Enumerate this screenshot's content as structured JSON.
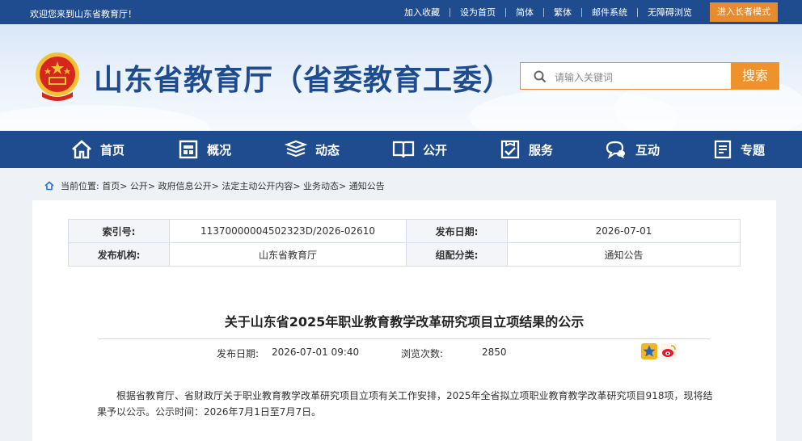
{
  "topbar": {
    "welcome": "欢迎您来到山东省教育厅！",
    "links": [
      "加入收藏",
      "设为首页",
      "简体",
      "繁体",
      "邮件系统",
      "无障碍浏览"
    ],
    "elder_mode": "进入长者模式"
  },
  "header": {
    "site_title": "山东省教育厅（省委教育工委）",
    "search_placeholder": "请输入关键词",
    "search_button": "搜索"
  },
  "nav": {
    "items": [
      {
        "label": "首页",
        "icon": "home-icon"
      },
      {
        "label": "概况",
        "icon": "overview-icon"
      },
      {
        "label": "动态",
        "icon": "news-icon"
      },
      {
        "label": "公开",
        "icon": "book-icon"
      },
      {
        "label": "服务",
        "icon": "service-icon"
      },
      {
        "label": "互动",
        "icon": "chat-icon"
      },
      {
        "label": "专题",
        "icon": "topic-icon"
      }
    ]
  },
  "breadcrumb": {
    "text": "当前位置: 首页> 公开> 政府信息公开> 法定主动公开内容> 业务动态> 通知公告"
  },
  "meta": {
    "index_label": "索引号:",
    "index_value": "11370000004502323D/2026-02610",
    "date_label": "发布日期:",
    "date_value": "2026-07-01",
    "org_label": "发布机构:",
    "org_value": "山东省教育厅",
    "category_label": "组配分类:",
    "category_value": "通知公告"
  },
  "article": {
    "title": "关于山东省2025年职业教育教学改革研究项目立项结果的公示",
    "pub_label": "发布日期:",
    "pub_value": "2026-07-01 09:40",
    "views_label": "浏览次数:",
    "views_value": "2850",
    "body": "根据省教育厅、省财政厅关于职业教育教学改革研究项目立项有关工作安排，2025年全省拟立项职业教育教学改革研究项目918项，现将结果予以公示。公示时间：2026年7月1日至7月7日。"
  },
  "colors": {
    "primary": "#1f4b8f",
    "accent": "#f0922c"
  }
}
